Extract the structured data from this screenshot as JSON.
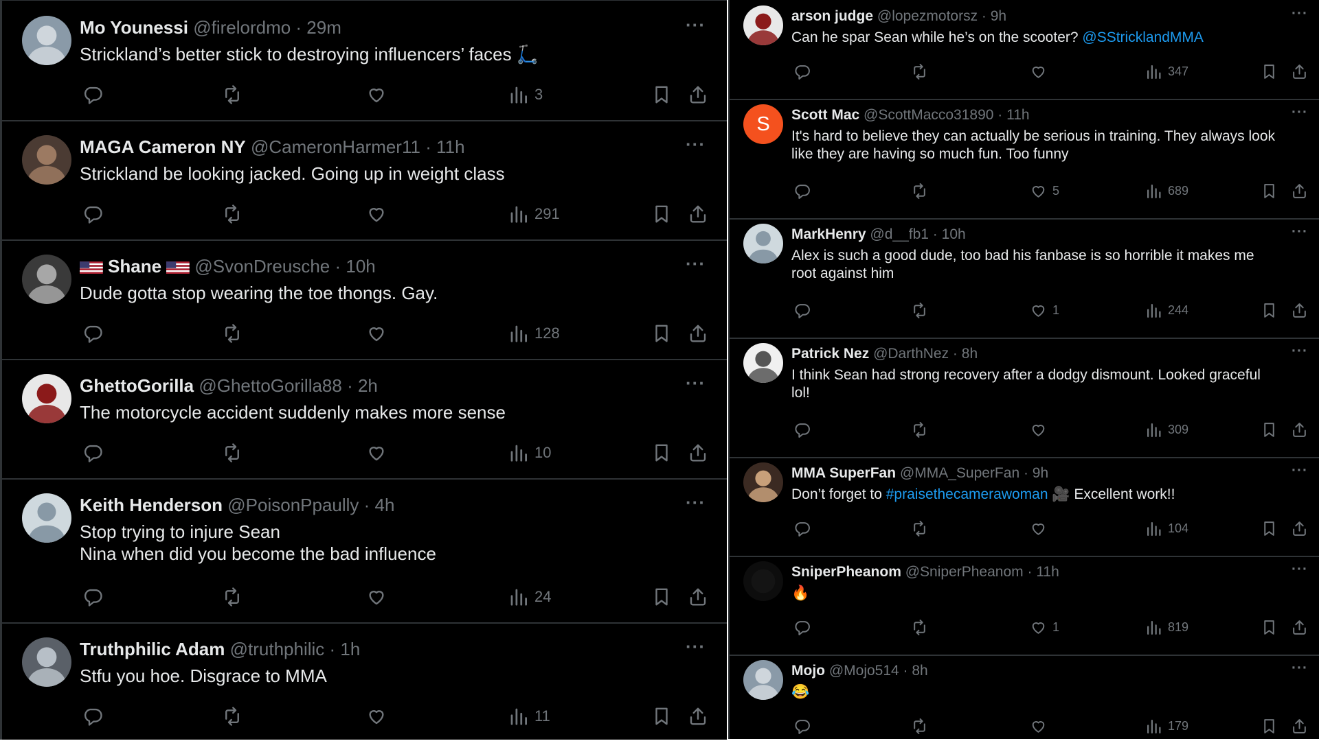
{
  "left_tweets": [
    {
      "name": "Mo Younessi",
      "handle": "@firelordmo",
      "time": "29m",
      "text": [
        "Strickland’s better stick to destroying influencers’ faces 🛴"
      ],
      "views": "3",
      "avatar": "photo"
    },
    {
      "name": "MAGA Cameron NY",
      "handle": "@CameronHarmer11",
      "time": "11h",
      "text": [
        "Strickland be looking jacked. Going up in weight class"
      ],
      "views": "291",
      "avatar": "photo"
    },
    {
      "name": "Shane",
      "handle": "@SvonDreusche",
      "time": "10h",
      "text": [
        "Dude gotta stop wearing the toe thongs. Gay."
      ],
      "views": "128",
      "avatar": "photo",
      "name_flags": "us-flag"
    },
    {
      "name": "GhettoGorilla",
      "handle": "@GhettoGorilla88",
      "time": "2h",
      "text": [
        "The motorcycle accident suddenly makes more sense"
      ],
      "views": "10",
      "avatar": "photo"
    },
    {
      "name": "Keith Henderson",
      "handle": "@PoisonPpaully",
      "time": "4h",
      "text": [
        "Stop trying to injure Sean",
        "Nina when did you become the bad influence"
      ],
      "views": "24",
      "avatar": "default"
    },
    {
      "name": "Truthphilic Adam",
      "handle": "@truthphilic",
      "time": "1h",
      "text": [
        "Stfu you hoe. Disgrace to MMA"
      ],
      "views": "11",
      "avatar": "photo"
    }
  ],
  "right_tweets": [
    {
      "name": "arson judge",
      "handle": "@lopezmotorsz",
      "time": "9h",
      "text": [
        "Can he spar Sean while he’s on the scooter? "
      ],
      "mention": "@SStricklandMMA",
      "likes": "",
      "views": "347",
      "avatar": "photo"
    },
    {
      "name": "Scott Mac",
      "handle": "@ScottMacco31890",
      "time": "11h",
      "text": [
        "It's hard to believe they can actually be serious in training. They always look",
        "like they are having so much fun. Too funny"
      ],
      "likes": "5",
      "views": "689",
      "avatar": "letter",
      "avatar_letter": "S"
    },
    {
      "name": "MarkHenry",
      "handle": "@d__fb1",
      "time": "10h",
      "text": [
        "Alex is such a good dude, too bad his fanbase is so horrible it makes me",
        "root against him"
      ],
      "likes": "1",
      "views": "244",
      "avatar": "default"
    },
    {
      "name": "Patrick Nez",
      "handle": "@DarthNez",
      "time": "8h",
      "text": [
        "I think Sean had strong recovery after a dodgy dismount. Looked graceful",
        "lol!"
      ],
      "likes": "",
      "views": "309",
      "avatar": "photo"
    },
    {
      "name": "MMA SuperFan",
      "handle": "@MMA_SuperFan",
      "time": "9h",
      "text_prefix": "Don’t forget to ",
      "hashtag": "#praisethecamerawoman",
      "text_suffix": " 🎥 Excellent work!!",
      "likes": "",
      "views": "104",
      "avatar": "photo"
    },
    {
      "name": "SniperPheanom",
      "handle": "@SniperPheanom",
      "time": "11h",
      "text": [
        "🔥"
      ],
      "likes": "1",
      "views": "819",
      "avatar": "dark"
    },
    {
      "name": "Mojo",
      "handle": "@Mojo514",
      "time": "8h",
      "text": [
        "😂"
      ],
      "likes": "",
      "views": "179",
      "avatar": "photo"
    }
  ],
  "colors": {
    "background": "#000000",
    "text": "#e7e9ea",
    "muted": "#71767b",
    "link": "#1d9bf0",
    "divider": "#2f3336",
    "letter_avatar": "#f4511e"
  },
  "icons": {
    "reply": "reply-icon",
    "repost": "repost-icon",
    "like": "like-icon",
    "views": "views-icon",
    "bookmark": "bookmark-icon",
    "share": "share-icon",
    "more": "more-icon"
  }
}
